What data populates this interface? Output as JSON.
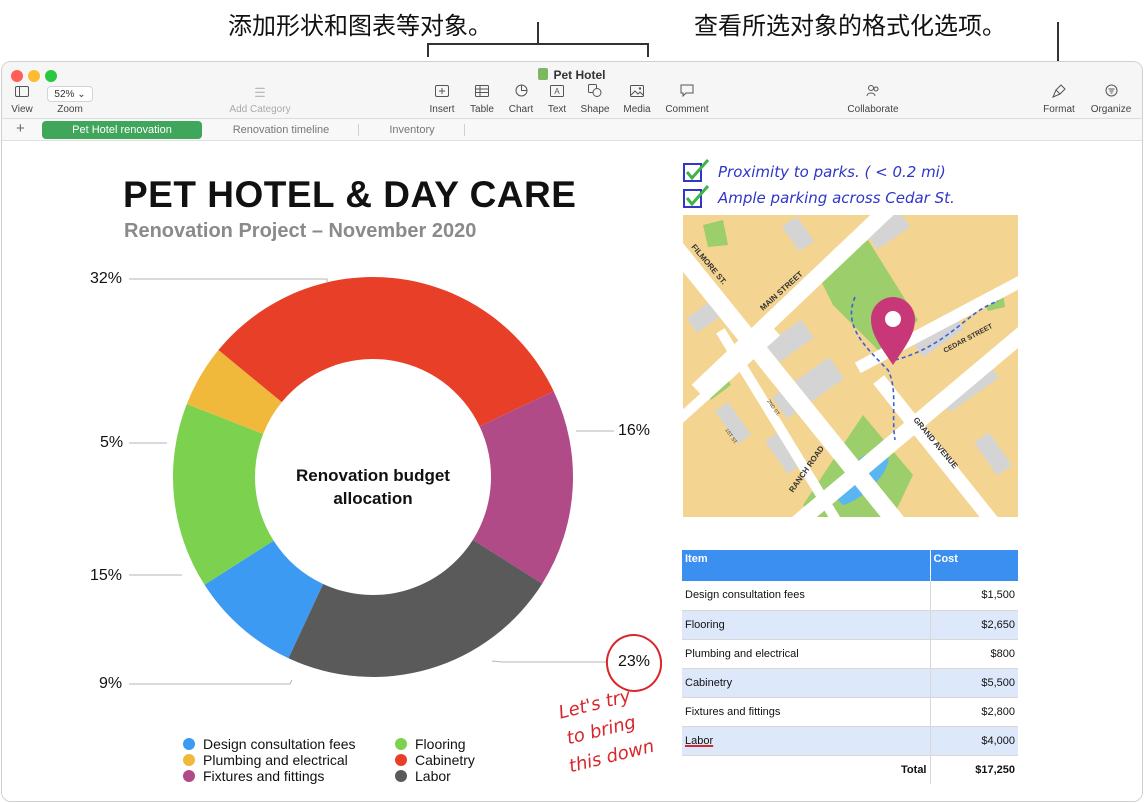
{
  "callouts": {
    "left": "添加形状和图表等对象。",
    "right": "查看所选对象的格式化选项。"
  },
  "window": {
    "title": "Pet Hotel",
    "traffic_colors": [
      "#ff5f57",
      "#febc2e",
      "#28c840"
    ]
  },
  "toolbar": {
    "view": "View",
    "zoom_value": "52%",
    "zoom": "Zoom",
    "add_category": "Add Category",
    "insert": "Insert",
    "table": "Table",
    "chart": "Chart",
    "text": "Text",
    "shape": "Shape",
    "media": "Media",
    "comment": "Comment",
    "collaborate": "Collaborate",
    "format": "Format",
    "organize": "Organize"
  },
  "sheets": {
    "add": "+",
    "tabs": [
      "Pet Hotel renovation",
      "Renovation timeline",
      "Inventory"
    ],
    "active_color": "#3fa65b"
  },
  "doc": {
    "title": "PET HOTEL & DAY CARE",
    "subtitle": "Renovation Project – November 2020"
  },
  "chart_data": {
    "type": "pie",
    "donut": true,
    "center_label": "Renovation budget allocation",
    "center_label_lines": [
      "Renovation budget",
      "allocation"
    ],
    "slices": [
      {
        "name": "Design consultation fees",
        "value": 9,
        "label": "9%",
        "color": "#3d9af2"
      },
      {
        "name": "Flooring",
        "value": 15,
        "label": "15%",
        "color": "#7cd14f"
      },
      {
        "name": "Plumbing and electrical",
        "value": 5,
        "label": "5%",
        "color": "#f0b93b"
      },
      {
        "name": "Cabinetry",
        "value": 32,
        "label": "32%",
        "color": "#e84028"
      },
      {
        "name": "Fixtures and fittings",
        "value": 16,
        "label": "16%",
        "color": "#b04b87"
      },
      {
        "name": "Labor",
        "value": 23,
        "label": "23%",
        "color": "#5a5a5a"
      }
    ],
    "legend": [
      {
        "label": "Design consultation fees",
        "color": "#3d9af2"
      },
      {
        "label": "Flooring",
        "color": "#7cd14f"
      },
      {
        "label": "Plumbing and electrical",
        "color": "#f0b93b"
      },
      {
        "label": "Cabinetry",
        "color": "#e84028"
      },
      {
        "label": "Fixtures and fittings",
        "color": "#b04b87"
      },
      {
        "label": "Labor",
        "color": "#5a5a5a"
      }
    ],
    "legend_position": "bottom"
  },
  "notes": {
    "check1": "Proximity to parks. ( < 0.2 mi)",
    "check2": "Ample parking across Cedar St.",
    "annotation_lines": [
      "Let's try",
      "to bring",
      "this down"
    ],
    "ink_blue": "#2f36c8",
    "ink_red": "#d8262b"
  },
  "map": {
    "streets": [
      "FILMORE ST.",
      "MAIN STREET",
      "CEDAR STREET",
      "GRAND AVENUE",
      "RANCH ROAD",
      "1ST ST.",
      "2ND ST."
    ],
    "colors": {
      "block": "#f4d491",
      "road": "#ffffff",
      "building": "#d4d4d4",
      "park": "#9cce6b",
      "water": "#5ab5f0",
      "pin": "#c83879"
    }
  },
  "table": {
    "headers": [
      "Item",
      "Cost"
    ],
    "rows": [
      {
        "item": "Design consultation fees",
        "cost": "$1,500"
      },
      {
        "item": "Flooring",
        "cost": "$2,650"
      },
      {
        "item": "Plumbing and electrical",
        "cost": "$800"
      },
      {
        "item": "Cabinetry",
        "cost": "$5,500"
      },
      {
        "item": "Fixtures and fittings",
        "cost": "$2,800"
      },
      {
        "item": "Labor",
        "cost": "$4,000"
      }
    ],
    "total_label": "Total",
    "total_value": "$17,250",
    "header_color": "#3a8ff0"
  }
}
